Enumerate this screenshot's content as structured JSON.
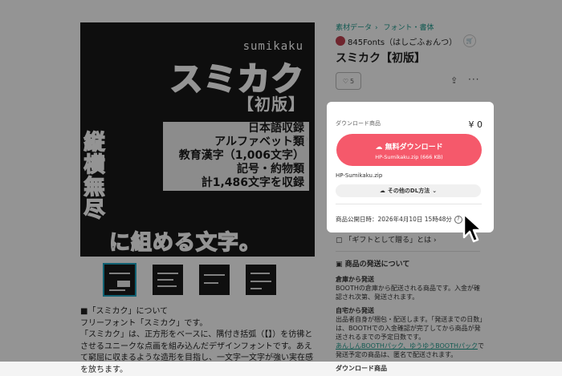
{
  "breadcrumb": {
    "category": "素材データ",
    "sep": "›",
    "subcategory": "フォント・書体"
  },
  "shop": {
    "name": "845Fonts（はしごふぉんつ）"
  },
  "product": {
    "title": "スミカク【初版】",
    "likes": "5"
  },
  "hero": {
    "title_en": "sumikaku",
    "title_jp": "スミカク",
    "edition": "【初版】",
    "info_lines": [
      "日本語収録",
      "アルファベット類",
      "教育漢字（1,006文字）",
      "記号・約物類",
      "計1,486文字を収録"
    ],
    "vertical_text": "縦横無尽",
    "bottom_text": "に組める文字。"
  },
  "purchase": {
    "item_type": "ダウンロード商品",
    "price": "¥ 0",
    "download_label": "無料ダウンロード",
    "download_file": "HP-Sumikaku.zip (666 KB)",
    "file_name": "HP-Sumikaku.zip",
    "other_dl_label": "その他のDL方法",
    "publish_date": "商品公開日時：2026年4月10日 15時48分"
  },
  "gift": {
    "label": "「ギフトとして贈る」とは",
    "chevron": "›"
  },
  "shipping": {
    "title": "商品の発送について",
    "warehouse_title": "倉庫から発送",
    "warehouse_text": "BOOTHの倉庫から配送される商品です。入金が確認され次第、発送されます。",
    "home_title": "自宅から発送",
    "home_text": "出品者自身が梱包・配送します。「発送までの日数」は、BOOTHでの入金確認が完了してから商品が発送されるまでの予定日数です。",
    "links": "あんしんBOOTHパック、ゆうゆうBOOTHパック",
    "links_suffix": "で発送予定の商品は、匿名で配送されます。",
    "dl_title": "ダウンロード商品"
  },
  "description": {
    "heading": "■「スミカク」について",
    "line1": "フリーフォント「スミカク」です。",
    "line2": "「スミカク」は、正方形をベースに、隅付き括弧（【】）を彷彿とさせるユニークな点画を組み込んだデザインフォントです。あえて窮屈に収まるような造形を目指し、一文字一文字が強い実在感を放ちます。"
  },
  "colors": {
    "accent": "#f5596b",
    "link": "#1e9a8c",
    "thumb_selected": "#1ea7c4"
  },
  "icons": [
    "avatar",
    "cart-icon",
    "heart-icon",
    "share-icon",
    "more-icon",
    "cloud-download-icon",
    "chevron-down-icon",
    "question-icon",
    "box-icon",
    "mouse-cursor"
  ]
}
